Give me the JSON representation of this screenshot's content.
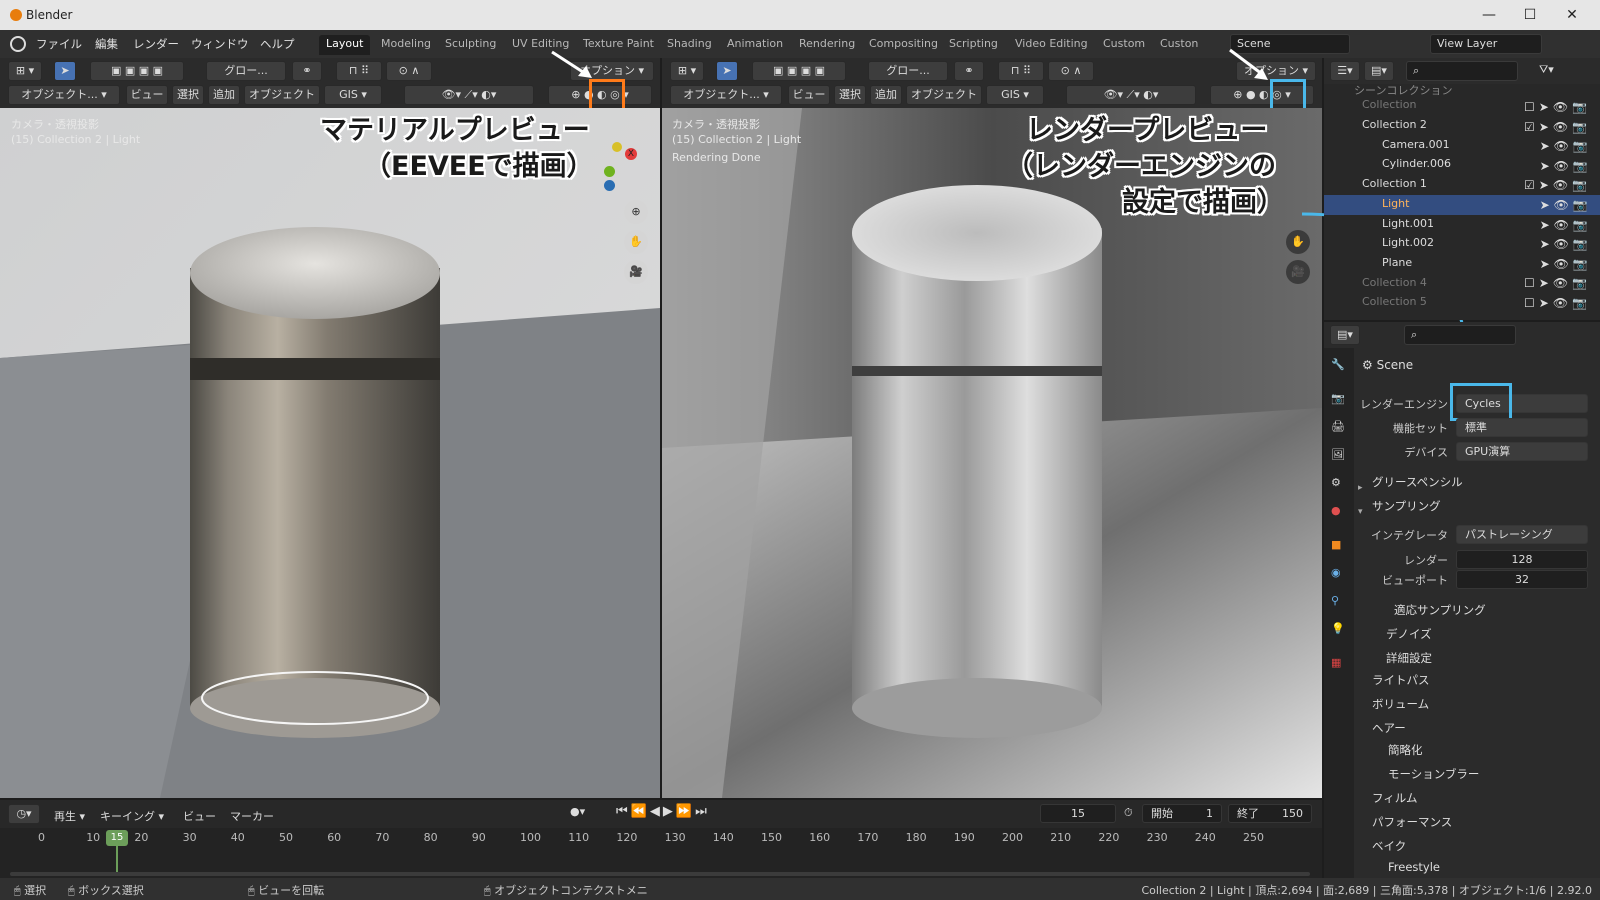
{
  "window": {
    "title": "Blender",
    "minimize": "—",
    "maximize": "☐",
    "close": "✕"
  },
  "menu": [
    "ファイル",
    "編集",
    "レンダー",
    "ウィンドウ",
    "ヘルプ"
  ],
  "workspaces": [
    "Layout",
    "Modeling",
    "Sculpting",
    "UV Editing",
    "Texture Paint",
    "Shading",
    "Animation",
    "Rendering",
    "Compositing",
    "Scripting",
    "Video Editing",
    "Custom",
    "Custon"
  ],
  "scene": "Scene",
  "view_layer": "View Layer",
  "vp_header": {
    "transform": "グロー...",
    "overlay": "オプション"
  },
  "vp_header2": {
    "mode": "オブジェクト...",
    "view": "ビュー",
    "select": "選択",
    "add": "追加",
    "object": "オブジェクト",
    "gis": "GIS"
  },
  "left_vp": {
    "line1": "カメラ・透視投影",
    "line2": "(15) Collection 2 | Light",
    "annot1": "マテリアルプレビュー",
    "annot2": "（EEVEEで描画）"
  },
  "right_vp": {
    "line1": "カメラ・透視投影",
    "line2": "(15) Collection 2 | Light",
    "line3": "Rendering Done",
    "annot1": "レンダープレビュー",
    "annot2": "（レンダーエンジンの",
    "annot3": "設定で描画）"
  },
  "outliner": {
    "top": "シーンコレクション",
    "rows": [
      "Collection",
      "Collection 2",
      "Camera.001",
      "Cylinder.006",
      "Collection 1",
      "Light",
      "Light.001",
      "Light.002",
      "Plane",
      "Collection 4",
      "Collection 5"
    ]
  },
  "props": {
    "scene": "Scene",
    "engine_label": "レンダーエンジン",
    "engine": "Cycles",
    "feature_label": "機能セット",
    "feature": "標準",
    "device_label": "デバイス",
    "device": "GPU演算",
    "grease": "グリースペンシル",
    "sampling": "サンプリング",
    "integrator_label": "インテグレータ",
    "integrator": "パストレーシング",
    "render_label": "レンダー",
    "render_val": "128",
    "viewport_label": "ビューポート",
    "viewport_val": "32",
    "adaptive": "適応サンプリング",
    "denoise": "デノイズ",
    "advanced": "詳細設定",
    "lightpaths": "ライトパス",
    "volume": "ボリューム",
    "hair": "ヘアー",
    "simplify": "簡略化",
    "motionblur": "モーションブラー",
    "film": "フィルム",
    "performance": "パフォーマンス",
    "bake": "ベイク",
    "freestyle": "Freestyle"
  },
  "timeline": {
    "play": "再生",
    "keying": "キーイング",
    "view": "ビュー",
    "marker": "マーカー",
    "frame": "15",
    "start_label": "開始",
    "start": "1",
    "end_label": "終了",
    "end": "150",
    "ticks": [
      "0",
      "10",
      "20",
      "30",
      "40",
      "50",
      "60",
      "70",
      "80",
      "90",
      "100",
      "110",
      "120",
      "130",
      "140",
      "150",
      "160",
      "170",
      "180",
      "190",
      "200",
      "210",
      "220",
      "230",
      "240",
      "250"
    ],
    "current": "15"
  },
  "status": {
    "select": "選択",
    "box": "ボックス選択",
    "rotate": "ビューを回転",
    "context": "オブジェクトコンテクストメニ",
    "info": "Collection 2 | Light | 頂点:2,694 | 面:2,689 | 三角面:5,378 | オブジェクト:1/6 | 2.92.0"
  },
  "colors": {
    "orange": "#ff7b1a",
    "cyan": "#4ab8ea",
    "accent": "#4772b3"
  }
}
